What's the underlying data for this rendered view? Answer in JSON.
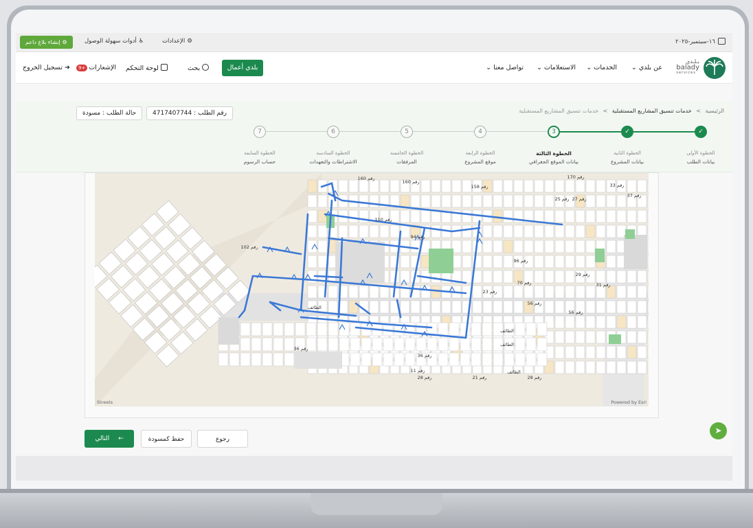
{
  "topbar": {
    "date": "١٦-سبتمبر-٢٠٢٥",
    "settings": "الإعدادات",
    "accessibility": "أدوات سهولة الوصول",
    "report": "إنشاء بلاغ داعم"
  },
  "nav": {
    "logo_ar": "بـلـدي",
    "logo_en": "balady",
    "logo_sub": "services",
    "about": "عن بلدي",
    "services": "الخدمات",
    "inquiries": "الاستعلامات",
    "contact": "تواصل معنا",
    "business": "بلدي أعمال",
    "search": "بحث",
    "dashboard": "لوحة التحكم",
    "notifications": "الإشعارات",
    "notifications_count": "+9",
    "logout": "تسجيل الخروج"
  },
  "breadcrumb": {
    "home": "الرئيسية",
    "sep": ">",
    "service": "خدمات تنسيق المشاريع المستقبلية",
    "current": "خدمات تنسيق المشاريع المستقبلية"
  },
  "request": {
    "number": "رقم الطلب : 4717407744",
    "status": "حالة الطلب : مسودة"
  },
  "steps": [
    {
      "num": "✓",
      "title": "الخطوة الأولى",
      "sub": "بيانات الطلب",
      "state": "done"
    },
    {
      "num": "✓",
      "title": "الخطوة الثانية",
      "sub": "بيانات المشروع",
      "state": "done"
    },
    {
      "num": "3",
      "title": "الخطوة الثالثة",
      "sub": "بيانات الموقع الجغرافي",
      "state": "active"
    },
    {
      "num": "4",
      "title": "الخطوة الرابعة",
      "sub": "موقع المشروع",
      "state": "todo"
    },
    {
      "num": "5",
      "title": "الخطوة الخامسة",
      "sub": "المرفقات",
      "state": "todo"
    },
    {
      "num": "6",
      "title": "الخطوة السادسة",
      "sub": "الاشتراطات والتعهدات",
      "state": "todo"
    },
    {
      "num": "7",
      "title": "الخطوة السابعة",
      "sub": "حساب الرسوم",
      "state": "todo"
    }
  ],
  "map": {
    "attribution_left": "Streets",
    "attribution_right": "Powered by Esri",
    "street_labels": [
      "رقم 160",
      "رقم 160",
      "رقم 158",
      "رقم 170",
      "رقم 25",
      "رقم 27",
      "رقم 33",
      "رقم 37",
      "رقم 110",
      "رقم 102",
      "رقم 94",
      "رقم 96",
      "رقم 70",
      "رقم 56",
      "رقم 56",
      "رقم 23",
      "رقم 29",
      "رقم 31",
      "رقم 36",
      "رقم 36",
      "رقم 28",
      "رقم 28",
      "رقم 11",
      "رقم 21",
      "الطائف",
      "الطائف",
      "الطائف",
      "الطائف"
    ],
    "colors": {
      "route": "#3a78d6",
      "park": "#8fcf95",
      "block": "#ffffff",
      "ground": "#efeae0"
    }
  },
  "actions": {
    "next": "التالي",
    "next_icon": "←",
    "draft": "حفظ كمسودة",
    "back": "رجوع"
  },
  "fab_icon": "send-icon"
}
